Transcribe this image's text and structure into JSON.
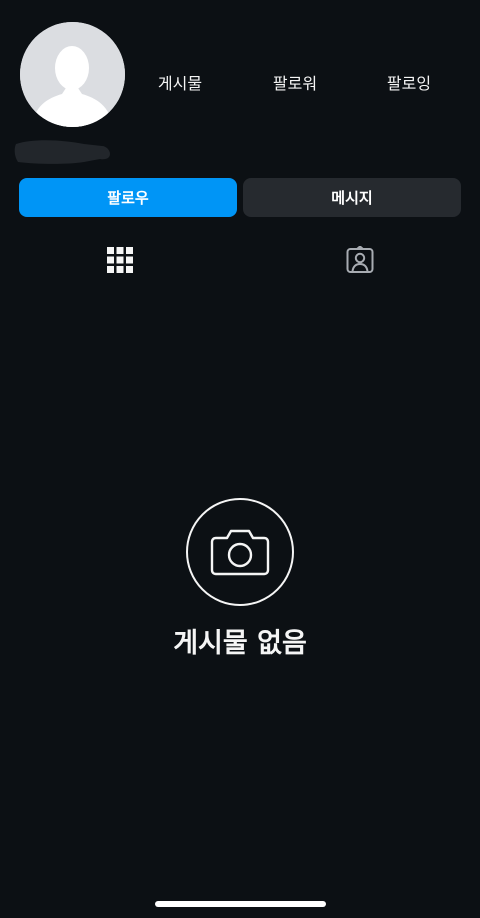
{
  "profile": {
    "stats": [
      {
        "label": "게시물"
      },
      {
        "label": "팔로워"
      },
      {
        "label": "팔로잉"
      }
    ]
  },
  "actions": {
    "follow_label": "팔로우",
    "message_label": "메시지"
  },
  "tabs": [
    {
      "icon": "grid-icon",
      "selected": true
    },
    {
      "icon": "tagged-user-icon",
      "selected": false
    }
  ],
  "empty_state": {
    "icon": "camera-icon",
    "title": "게시물 없음"
  },
  "colors": {
    "background": "#0c1014",
    "accent": "#0095f6",
    "secondary_button": "#262a2f",
    "text": "#f5f5f5"
  }
}
